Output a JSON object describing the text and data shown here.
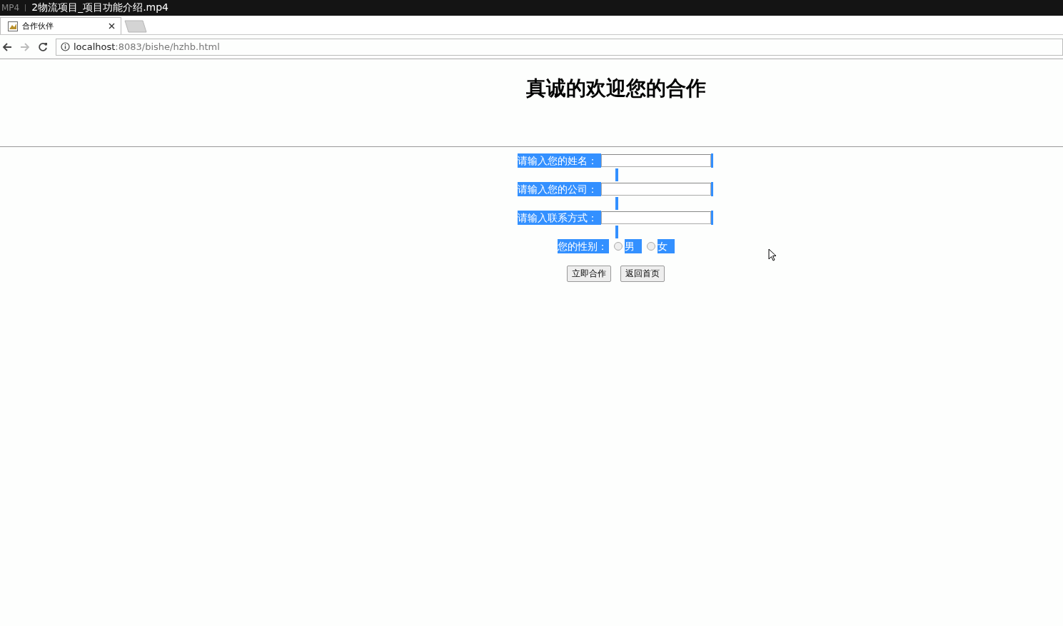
{
  "player": {
    "format": "MP4",
    "title": "2物流项目_项目功能介绍.mp4"
  },
  "tabs": [
    {
      "label": "合作伙伴",
      "selected": true
    }
  ],
  "address": {
    "host": "localhost",
    "path": ":8083/bishe/hzhb.html"
  },
  "heading": "真诚的欢迎您的合作",
  "fields": [
    {
      "label": "请输入您的姓名："
    },
    {
      "label": "请输入您的公司："
    },
    {
      "label": "请输入联系方式："
    }
  ],
  "gender": {
    "label": "您的性别：",
    "options": [
      {
        "label": "男",
        "selected": false
      },
      {
        "label": "女",
        "selected": false
      }
    ]
  },
  "buttons": [
    "立即合作",
    "返回首页"
  ]
}
